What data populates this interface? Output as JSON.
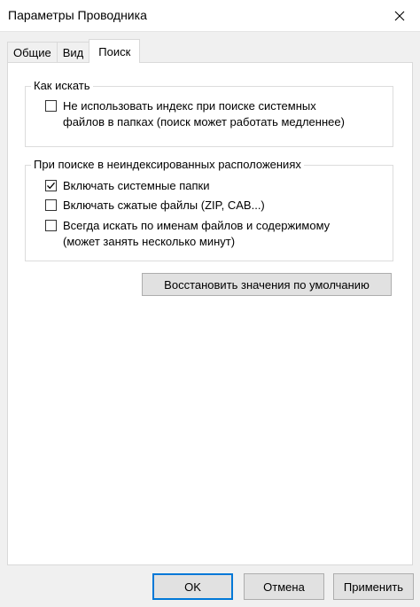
{
  "window": {
    "title": "Параметры Проводника"
  },
  "tabs": [
    {
      "label": "Общие",
      "active": false
    },
    {
      "label": "Вид",
      "active": false
    },
    {
      "label": "Поиск",
      "active": true
    }
  ],
  "groups": {
    "how_to_search": {
      "title": "Как искать",
      "options": [
        {
          "label": "Не использовать индекс при поиске системных\nфайлов в папках (поиск может работать медленнее)",
          "checked": false
        }
      ]
    },
    "non_indexed": {
      "title": "При поиске в неиндексированных расположениях",
      "options": [
        {
          "label": "Включать системные папки",
          "checked": true
        },
        {
          "label": "Включать сжатые файлы (ZIP, CAB...)",
          "checked": false
        },
        {
          "label": "Всегда искать по именам файлов и содержимому\n(может занять несколько минут)",
          "checked": false
        }
      ]
    }
  },
  "restore_button": {
    "label": "Восстановить значения по умолчанию"
  },
  "buttons": {
    "ok": "OK",
    "cancel": "Отмена",
    "apply": "Применить"
  },
  "colors": {
    "accent": "#0078d7",
    "window_bg": "#f0f0f0",
    "panel_bg": "#ffffff"
  },
  "icons": {
    "close": "close-icon",
    "check": "checkmark-icon"
  }
}
